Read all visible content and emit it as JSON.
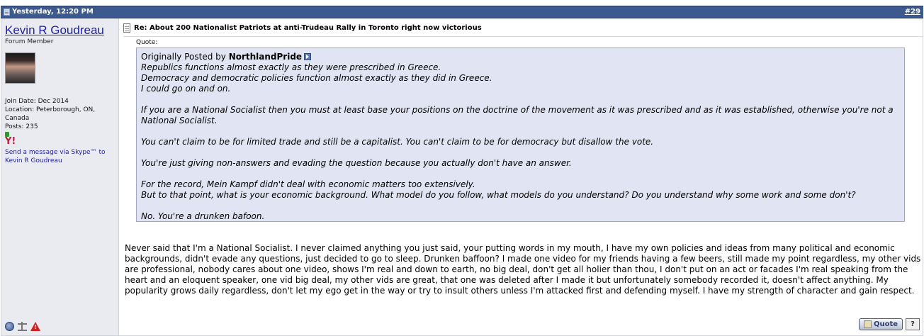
{
  "post": {
    "date": "Yesterday, 12:20 PM",
    "number": "#29",
    "title": "Re: About 200 Nationalist Patriots at anti-Trudeau Rally in Toronto right now victorious"
  },
  "user": {
    "name": "Kevin R Goudreau",
    "title": "Forum Member",
    "join_date": "Join Date: Dec 2014",
    "location": "Location: Peterborough, ON, Canada",
    "posts": "Posts: 235",
    "skype_link": "Send a message via Skype™ to Kevin R Goudreau"
  },
  "quote": {
    "label": "Quote:",
    "originally_posted_by": "Originally Posted by",
    "author": "NorthlandPride",
    "lines": [
      "Republics functions almost exactly as they were prescribed in Greece.",
      "Democracy and democratic policies function almost exactly as they did in Greece.",
      "I could go on and on.",
      "If you are a National Socialist then you must at least base your positions on the doctrine of the movement as it was prescribed and as it was established, otherwise you're not a National Socialist.",
      "You can't claim to be for limited trade and still be a capitalist. You can't claim to be for democracy but disallow the vote.",
      "You're just giving non-answers and evading the question because you actually don't have an answer.",
      "For the record, Mein Kampf didn't deal with economic matters too extensively.",
      "But to that point, what is your economic background. What model do you follow, what models do you understand? Do you understand why some work and some don't?",
      "No. You're a drunken bafoon."
    ]
  },
  "message": "Never said that I'm a National Socialist. I never claimed anything you just said, your putting words in my mouth, I have my own policies and ideas from many political and economic backgrounds, didn't evade any questions, just decided to go to sleep. Drunken baffoon? I made one video for my friends having a few beers, still made my point regardless, my other vids are professional, nobody cares about one video, shows I'm real and down to earth, no big deal, don't get all holier than thou, I don't put on an act or facades I'm real speaking from the heart and an eloquent speaker, one vid big deal, my other vids are great, that one was deleted after I made it but unfortunately somebody recorded it, doesn't affect anything. My popularity grows daily regardless, don't let my ego get in the way or try to insult others unless I'm attacked first and defending myself. I have my strength of character and gain respect.",
  "buttons": {
    "quote": "Quote",
    "multiquote": "?"
  },
  "colors": {
    "header_bg": "#3c5a8f",
    "userbox_bg": "#e9ebf1",
    "quote_bg": "#e1e4f2",
    "link": "#22229c"
  }
}
